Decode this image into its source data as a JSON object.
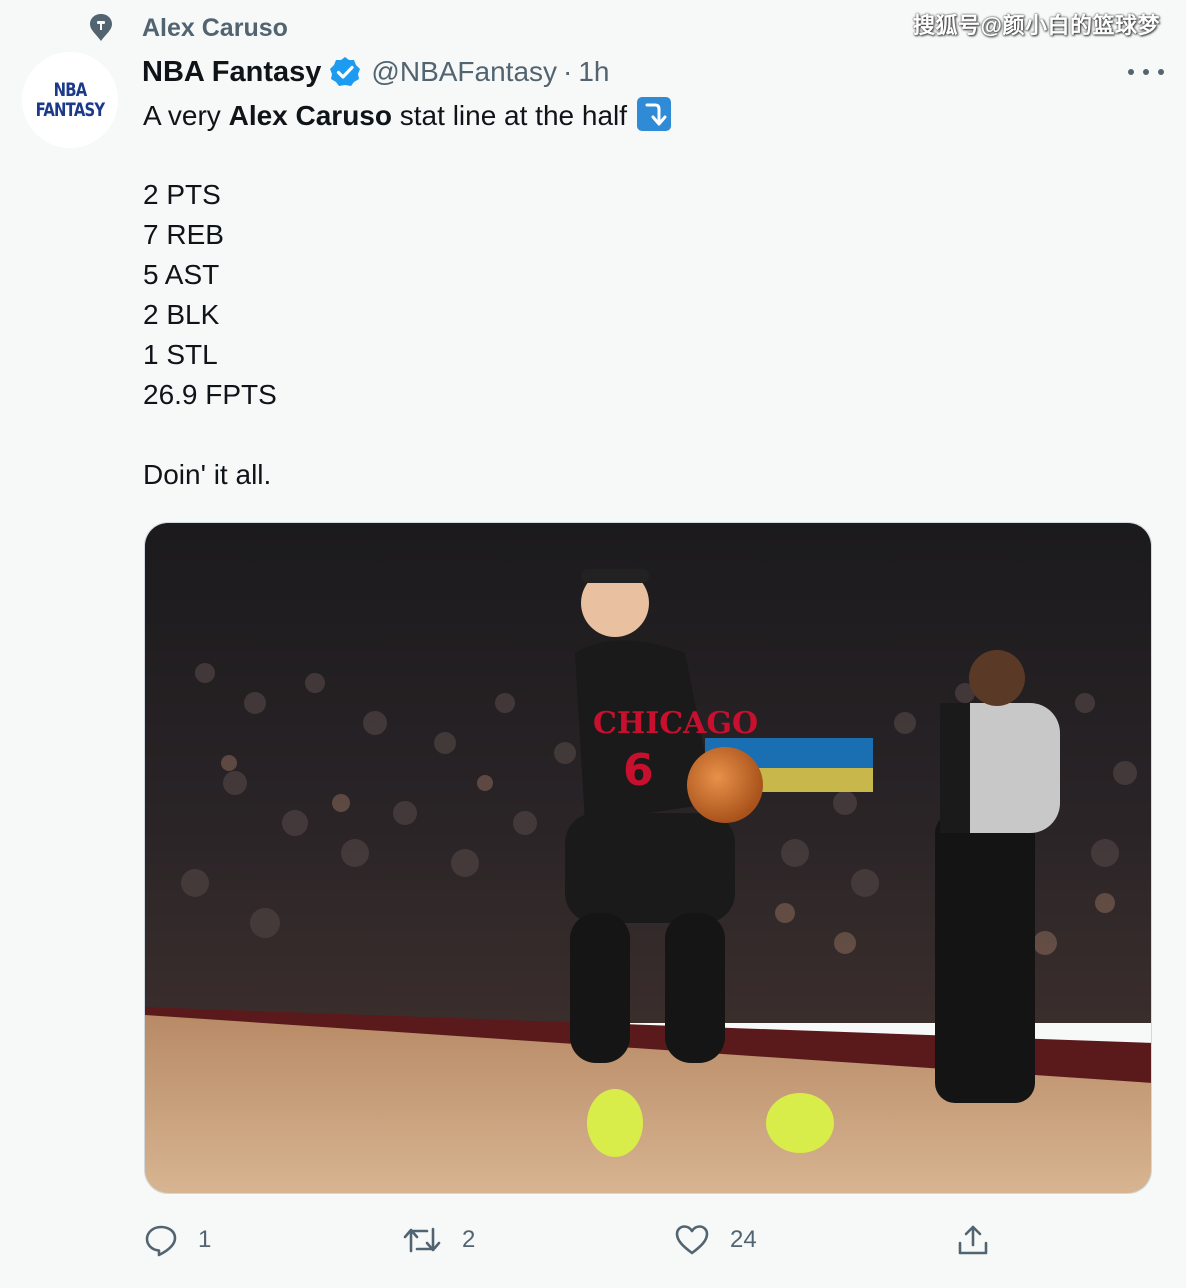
{
  "social_context": {
    "text": "Alex Caruso",
    "icon": "pin-icon"
  },
  "watermark": "搜狐号@颜小白的篮球梦",
  "avatar": {
    "line1": "NBA",
    "line2": "FANTASY"
  },
  "author": {
    "name": "NBA Fantasy",
    "handle": "@NBAFantasy",
    "separator": "·",
    "time": "1h",
    "verified": true
  },
  "tweet": {
    "intro_prefix": "A very ",
    "intro_bold": "Alex Caruso",
    "intro_suffix": " stat line at the half",
    "stats": [
      "2 PTS",
      "7 REB",
      "5 AST",
      "2 BLK",
      "1 STL",
      "26.9 FPTS"
    ],
    "closing": "Doin' it all."
  },
  "photo": {
    "jersey_text": "CHICAGO",
    "jersey_number": "6"
  },
  "actions": {
    "reply_count": "1",
    "retweet_count": "2",
    "like_count": "24"
  },
  "colors": {
    "background": "#f7f9f9",
    "text": "#0f1419",
    "secondary": "#536471",
    "verified": "#1d9bf0",
    "jersey": "#1a1a1a",
    "jersey_accent": "#c8102e"
  }
}
